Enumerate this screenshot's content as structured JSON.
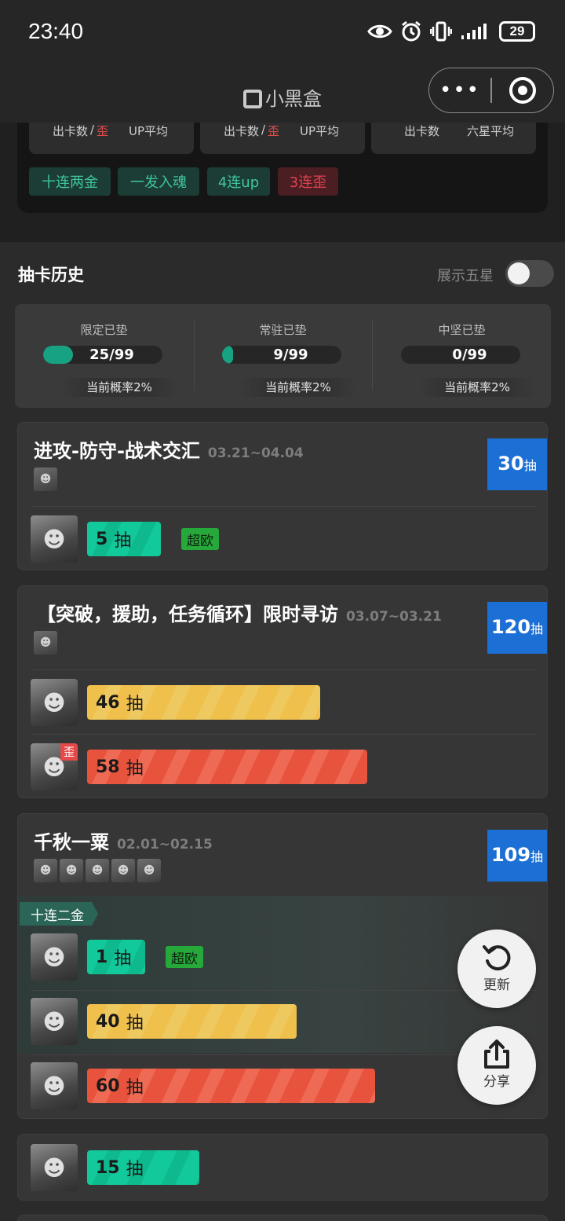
{
  "status_bar": {
    "time": "23:40",
    "battery": "29"
  },
  "nav": {
    "title": "小黑盒",
    "more": "•••"
  },
  "summary": {
    "stats": [
      {
        "label_a": "出卡数",
        "slash": "/",
        "label_wai": "歪",
        "label_b": "UP平均"
      },
      {
        "label_a": "出卡数",
        "slash": "/",
        "label_wai": "歪",
        "label_b": "UP平均"
      },
      {
        "label_a": "出卡数",
        "slash": "",
        "label_wai": "",
        "label_b": "六星平均"
      }
    ],
    "tags": [
      "十连两金",
      "一发入魂",
      "4连up",
      "3连歪"
    ]
  },
  "history": {
    "title": "抽卡历史",
    "toggle_label": "展示五星",
    "toggle_on": false
  },
  "pity": [
    {
      "label": "限定已垫",
      "value": "25/99",
      "fraction": 0.2525,
      "rate": "当前概率2%"
    },
    {
      "label": "常驻已垫",
      "value": "9/99",
      "fraction": 0.0909,
      "rate": "当前概率2%"
    },
    {
      "label": "中坚已垫",
      "value": "0/99",
      "fraction": 0,
      "rate": "当前概率2%"
    }
  ],
  "banners": [
    {
      "title": "进攻-防守-战术交汇",
      "date": "03.21~04.04",
      "pulls": "30",
      "pull_unit": "抽",
      "rows": [
        {
          "count": "5",
          "unit": "抽",
          "lucky": "超欧"
        }
      ]
    },
    {
      "title": "【突破，援助，任务循环】限时寻访",
      "date": "03.07~03.21",
      "pulls": "120",
      "pull_unit": "抽",
      "rows": [
        {
          "count": "46",
          "unit": "抽"
        },
        {
          "count": "58",
          "unit": "抽",
          "wai": "歪"
        }
      ]
    },
    {
      "title": "千秋一粟",
      "date": "02.01~02.15",
      "pulls": "109",
      "pull_unit": "抽",
      "tenpull_tag": "十连二金",
      "rows": [
        {
          "count": "1",
          "unit": "抽",
          "lucky": "超欧"
        },
        {
          "count": "40",
          "unit": "抽"
        },
        {
          "count": "60",
          "unit": "抽"
        }
      ]
    },
    {
      "rows": [
        {
          "count": "15",
          "unit": "抽"
        }
      ]
    }
  ],
  "fab": {
    "refresh": "更新",
    "share": "分享"
  },
  "colors": {
    "accent_green": "#12c99b",
    "badge_blue": "#1c6fd4",
    "warn_red": "#e8533d",
    "mid_yellow": "#f0c04c"
  }
}
